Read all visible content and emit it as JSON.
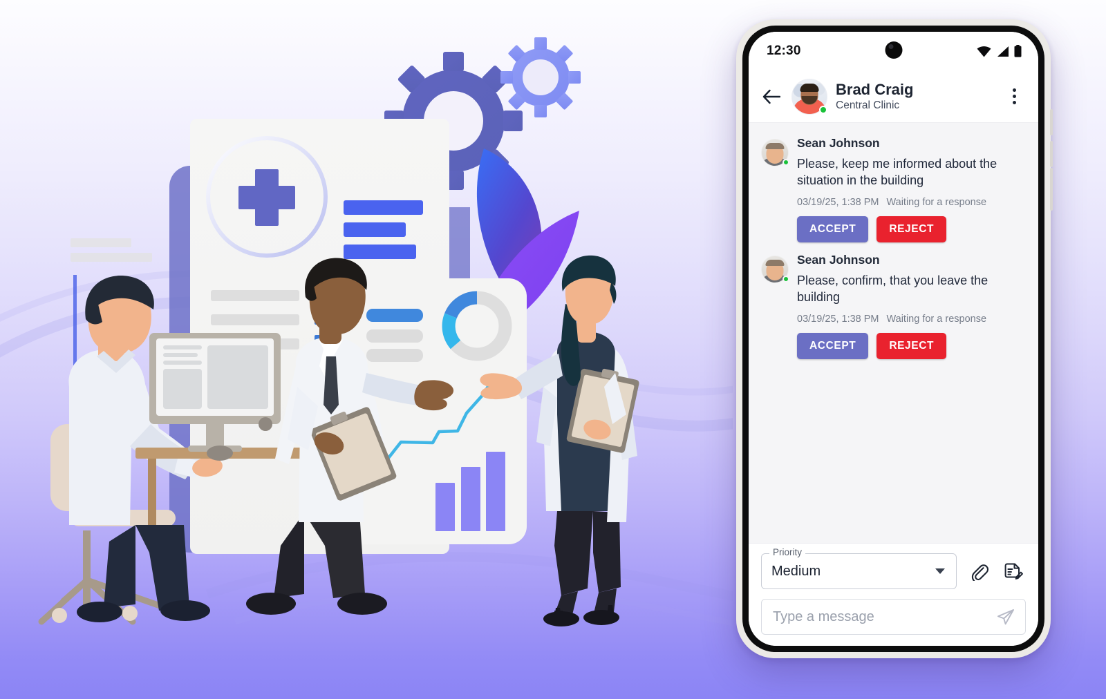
{
  "illustration": {
    "alt_name": "medical-team-analytics-illustration",
    "background_gradient": {
      "top": "#fdfdff",
      "bottom": "#8b84f5"
    },
    "accent_colors": {
      "indigo": "#6b6fc4",
      "blue": "#4569e8",
      "purple": "#8b5cf6",
      "cyan": "#35b4e8",
      "periwinkle": "#8b84f5"
    },
    "elements": [
      "gear-large",
      "gear-small",
      "leaf-blue",
      "leaf-purple",
      "medical-document-card",
      "plus-cross-circle",
      "donut-chart",
      "bar-chart",
      "line-chart",
      "doctor-at-computer",
      "doctor-pointing",
      "nurse-with-clipboard"
    ]
  },
  "phone": {
    "status_bar": {
      "time": "12:30",
      "icons": [
        "wifi-icon",
        "signal-icon",
        "battery-icon"
      ]
    },
    "header": {
      "back_icon": "back-arrow-icon",
      "contact_name": "Brad Craig",
      "contact_subtitle": "Central Clinic",
      "menu_icon": "kebab-menu-icon",
      "online": true
    },
    "messages": [
      {
        "sender": "Sean Johnson",
        "text": "Please, keep me informed about the situation in the building",
        "timestamp": "03/19/25, 1:38 PM",
        "status": "Waiting for a response",
        "accept_label": "ACCEPT",
        "reject_label": "REJECT"
      },
      {
        "sender": "Sean Johnson",
        "text": "Please, confirm, that you leave the building",
        "timestamp": "03/19/25, 1:38 PM",
        "status": "Waiting for a response",
        "accept_label": "ACCEPT",
        "reject_label": "REJECT"
      }
    ],
    "composer": {
      "priority_label": "Priority",
      "priority_value": "Medium",
      "attach_icon": "paperclip-icon",
      "template_icon": "document-edit-icon",
      "message_placeholder": "Type a message",
      "message_value": "",
      "send_icon": "send-paper-plane-icon"
    }
  },
  "colors": {
    "accept_button": "#6b6fc4",
    "reject_button": "#e9222e",
    "online_dot": "#19c139",
    "chat_background": "#f5f5f7"
  }
}
